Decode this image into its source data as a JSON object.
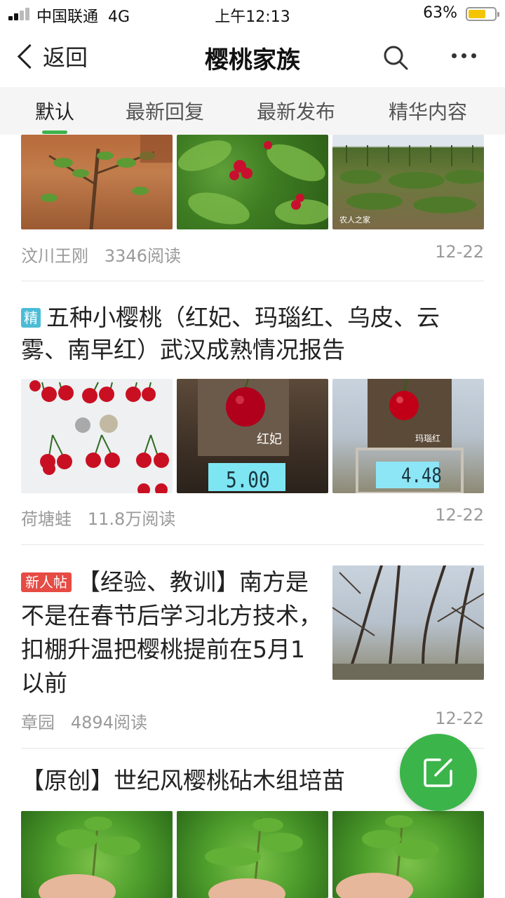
{
  "status_bar": {
    "carrier": "中国联通",
    "network": "4G",
    "time": "上午12:13",
    "battery_percent": "63%",
    "battery_color": "#f5c400"
  },
  "header": {
    "back_label": "返回",
    "title": "樱桃家族",
    "search_icon": "search-icon",
    "more_icon": "more-icon"
  },
  "tabs": [
    {
      "label": "默认",
      "active": true
    },
    {
      "label": "最新回复",
      "active": false
    },
    {
      "label": "最新发布",
      "active": false
    },
    {
      "label": "精华内容",
      "active": false
    }
  ],
  "accent_color": "#3cb34a",
  "posts": [
    {
      "author": "汶川王刚",
      "reads": "3346阅读",
      "date": "12-22",
      "watermark": "农人之家"
    },
    {
      "badge": "精",
      "title": "五种小樱桃（红妃、玛瑙红、乌皮、云雾、南早红）武汉成熟情况报告",
      "image_labels": [
        "红妃",
        "玛瑙红"
      ],
      "scale_readings": [
        "5.00",
        "4.48"
      ],
      "author": "荷塘蛙",
      "reads": "11.8万阅读",
      "date": "12-22"
    },
    {
      "badge": "新人帖",
      "title": "【经验、教训】南方是不是在春节后学习北方技术，扣棚升温把樱桃提前在5月1以前",
      "author": "章园",
      "reads": "4894阅读",
      "date": "12-22"
    },
    {
      "title": "【原创】世纪风樱桃砧木组培苗"
    }
  ],
  "fab": {
    "icon": "compose-icon",
    "color": "#3bb54a"
  }
}
